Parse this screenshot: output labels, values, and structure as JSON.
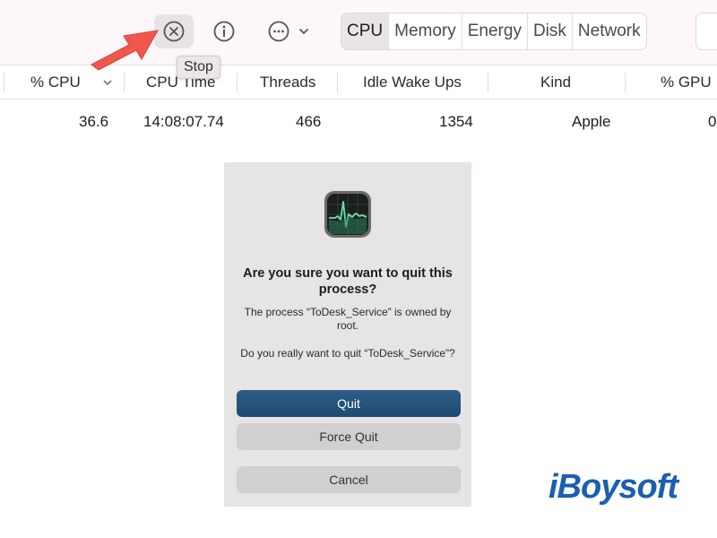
{
  "toolbar": {
    "stop_tooltip": "Stop",
    "tabs": [
      {
        "label": "CPU",
        "active": true
      },
      {
        "label": "Memory",
        "active": false
      },
      {
        "label": "Energy",
        "active": false
      },
      {
        "label": "Disk",
        "active": false
      },
      {
        "label": "Network",
        "active": false
      }
    ]
  },
  "table": {
    "headers": [
      "% CPU",
      "CPU Time",
      "Threads",
      "Idle Wake Ups",
      "Kind",
      "% GPU"
    ],
    "row": [
      "36.6",
      "14:08:07.74",
      "466",
      "1354",
      "Apple",
      "0"
    ]
  },
  "dialog": {
    "title": "Are you sure you want to quit this process?",
    "message1": "The process “ToDesk_Service” is owned by root.",
    "message2": "Do you really want to quit “ToDesk_Service”?",
    "quit_label": "Quit",
    "force_quit_label": "Force Quit",
    "cancel_label": "Cancel"
  },
  "watermark": "iBoysoft",
  "colors": {
    "accent_button": "#1e4a70",
    "arrow": "#f0574d",
    "watermark": "#1a5fb0"
  }
}
